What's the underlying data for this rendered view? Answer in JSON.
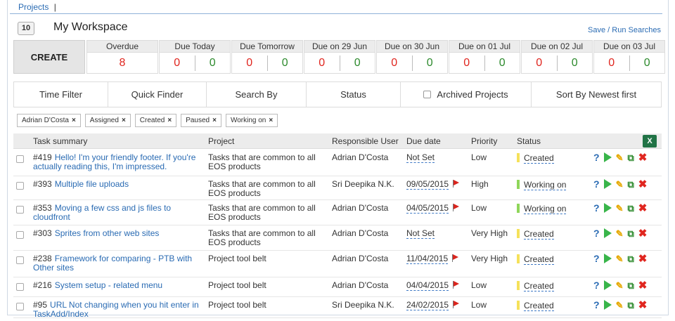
{
  "breadcrumb": {
    "projects": "Projects",
    "separator": "|"
  },
  "workspace": {
    "count": "10",
    "title": "My Workspace",
    "save_run": "Save / Run Searches"
  },
  "create": {
    "label": "CREATE"
  },
  "due_buckets": [
    {
      "label": "Overdue",
      "red": "8"
    },
    {
      "label": "Due Today",
      "red": "0",
      "green": "0"
    },
    {
      "label": "Due Tomorrow",
      "red": "0",
      "green": "0"
    },
    {
      "label": "Due on 29 Jun",
      "red": "0",
      "green": "0"
    },
    {
      "label": "Due on 30 Jun",
      "red": "0",
      "green": "0"
    },
    {
      "label": "Due on 01 Jul",
      "red": "0",
      "green": "0"
    },
    {
      "label": "Due on 02 Jul",
      "red": "0",
      "green": "0"
    },
    {
      "label": "Due on 03 Jul",
      "red": "0",
      "green": "0"
    }
  ],
  "filters": {
    "time_filter": "Time Filter",
    "quick_finder": "Quick Finder",
    "search_by": "Search By",
    "status": "Status",
    "archived": "Archived Projects",
    "sort": "Sort By Newest first"
  },
  "tags": [
    {
      "label": "Adrian D'Costa"
    },
    {
      "label": "Assigned"
    },
    {
      "label": "Created"
    },
    {
      "label": "Paused"
    },
    {
      "label": "Working on"
    }
  ],
  "columns": {
    "summary": "Task summary",
    "project": "Project",
    "user": "Responsible User",
    "due": "Due date",
    "priority": "Priority",
    "status": "Status",
    "excel": "X"
  },
  "colors": {
    "status_created": "#f5e15a",
    "status_working": "#8fd65a",
    "accent": "#2a6bb3"
  },
  "icons": [
    "help-icon",
    "play-icon",
    "edit-icon",
    "copy-icon",
    "delete-icon",
    "excel-icon",
    "flag-icon",
    "close-icon"
  ],
  "rows": [
    {
      "id": "#419",
      "title": "Hello! I'm your friendly footer. If you're actually reading this, I'm impressed.",
      "project": "Tasks that are common to all EOS products",
      "user": "Adrian D'Costa",
      "due": "Not Set",
      "flag": false,
      "priority": "Low",
      "status": "Created",
      "status_type": "created"
    },
    {
      "id": "#393",
      "title": "Multiple file uploads",
      "project": "Tasks that are common to all EOS products",
      "user": "Sri Deepika N.K.",
      "due": "09/05/2015",
      "flag": true,
      "priority": "High",
      "status": "Working on",
      "status_type": "working"
    },
    {
      "id": "#353",
      "title": "Moving a few css and js files to cloudfront",
      "project": "Tasks that are common to all EOS products",
      "user": "Adrian D'Costa",
      "due": "04/05/2015",
      "flag": true,
      "priority": "Low",
      "status": "Working on",
      "status_type": "working"
    },
    {
      "id": "#303",
      "title": "Sprites from other web sites",
      "project": "Tasks that are common to all EOS products",
      "user": "Adrian D'Costa",
      "due": "Not Set",
      "flag": false,
      "priority": "Very High",
      "status": "Created",
      "status_type": "created"
    },
    {
      "id": "#238",
      "title": "Framework for comparing - PTB with Other sites",
      "project": "Project tool belt",
      "user": "Adrian D'Costa",
      "due": "11/04/2015",
      "flag": true,
      "priority": "Very High",
      "status": "Created",
      "status_type": "created"
    },
    {
      "id": "#216",
      "title": "System setup - related menu",
      "project": "Project tool belt",
      "user": "Adrian D'Costa",
      "due": "04/04/2015",
      "flag": true,
      "priority": "Low",
      "status": "Created",
      "status_type": "created"
    },
    {
      "id": "#95",
      "title": "URL Not changing when you hit enter in TaskAdd/Index",
      "project": "Project tool belt",
      "user": "Sri Deepika N.K.",
      "due": "24/02/2015",
      "flag": true,
      "priority": "Low",
      "status": "Created",
      "status_type": "created"
    }
  ]
}
